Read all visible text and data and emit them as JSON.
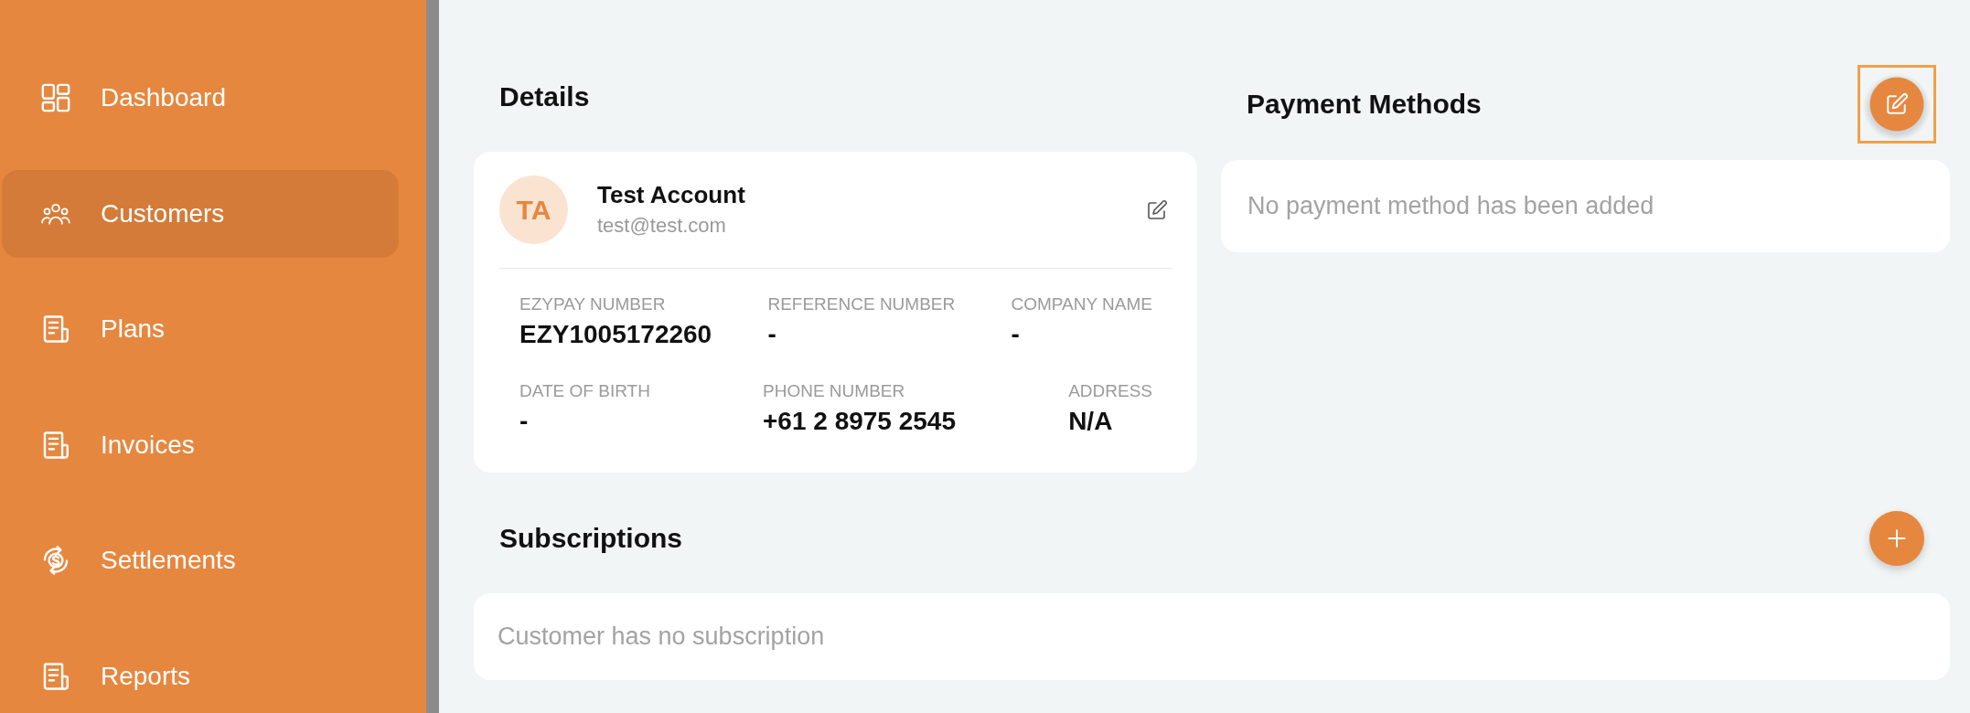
{
  "sidebar": {
    "items": [
      {
        "label": "Dashboard",
        "selected": false
      },
      {
        "label": "Customers",
        "selected": true
      },
      {
        "label": "Plans",
        "selected": false
      },
      {
        "label": "Invoices",
        "selected": false
      },
      {
        "label": "Settlements",
        "selected": false
      },
      {
        "label": "Reports",
        "selected": false
      }
    ]
  },
  "details": {
    "title": "Details",
    "customer": {
      "initials": "TA",
      "name": "Test Account",
      "email": "test@test.com"
    },
    "field_rows": [
      [
        {
          "label": "EZYPAY NUMBER",
          "value": "EZY1005172260"
        },
        {
          "label": "REFERENCE NUMBER",
          "value": "-"
        },
        {
          "label": "COMPANY NAME",
          "value": "-"
        }
      ],
      [
        {
          "label": "DATE OF BIRTH",
          "value": "-"
        },
        {
          "label": "PHONE NUMBER",
          "value": "+61 2 8975 2545"
        },
        {
          "label": "ADDRESS",
          "value": "N/A"
        }
      ]
    ]
  },
  "payment_methods": {
    "title": "Payment Methods",
    "edit_button": {
      "focused": true
    },
    "empty_message": "No payment method has been added"
  },
  "subscriptions": {
    "title": "Subscriptions",
    "add_button": {
      "focused": false
    },
    "empty_message": "Customer has no subscription"
  }
}
